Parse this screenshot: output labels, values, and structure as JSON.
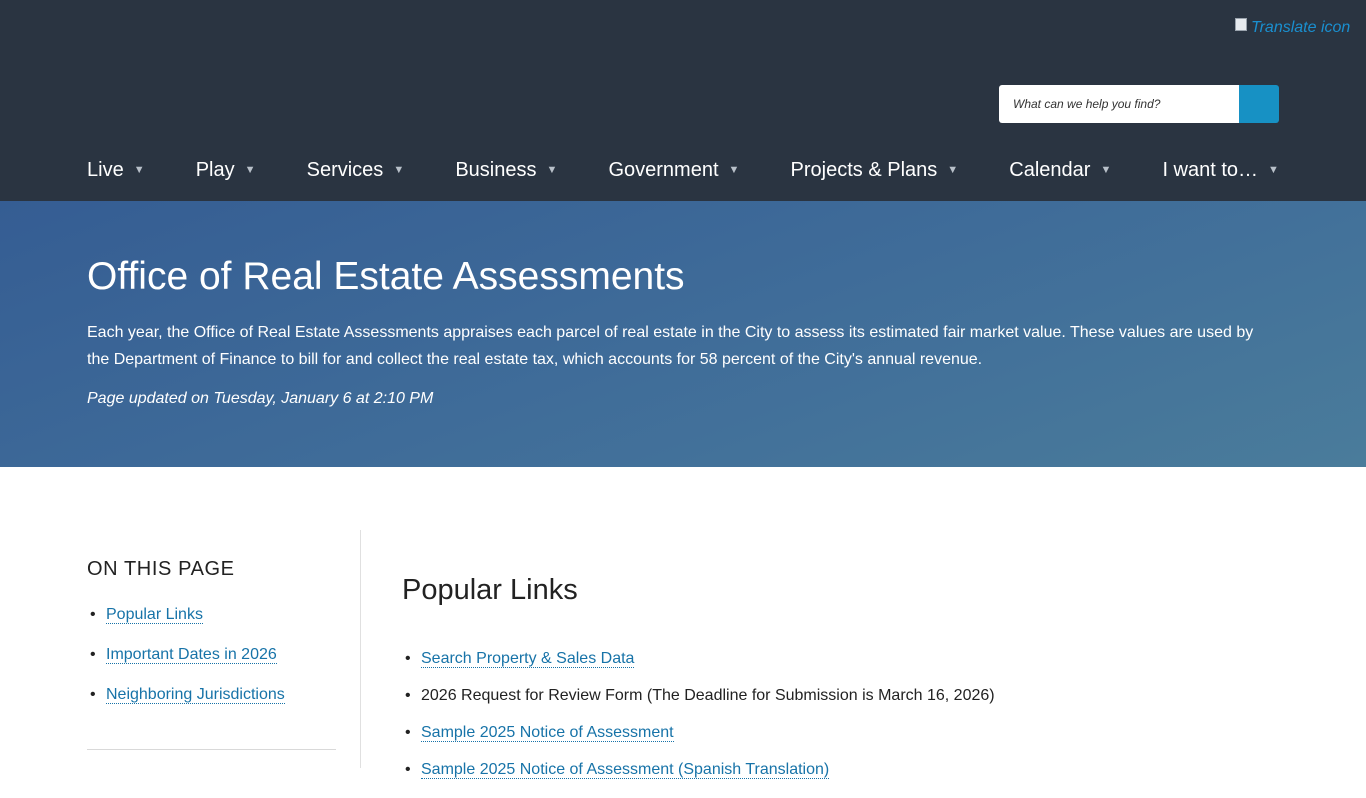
{
  "header": {
    "translate_alt": "Translate icon",
    "search": {
      "placeholder": "What can we help you find?"
    },
    "nav": [
      {
        "label": "Live"
      },
      {
        "label": "Play"
      },
      {
        "label": "Services"
      },
      {
        "label": "Business"
      },
      {
        "label": "Government"
      },
      {
        "label": "Projects & Plans"
      },
      {
        "label": "Calendar"
      },
      {
        "label": "I want to…"
      }
    ],
    "caret_glyph": "▼"
  },
  "hero": {
    "title": "Office of Real Estate Assessments",
    "intro": "Each year, the Office of Real Estate Assessments appraises each parcel of real estate in the City to assess its estimated fair market value. These values are used by the Department of Finance to bill for and collect the real estate tax, which accounts for 58 percent of the City's annual revenue.",
    "updated": "Page updated on Tuesday, January 6 at 2:10 PM"
  },
  "sidebar": {
    "heading": "ON THIS PAGE",
    "links": [
      {
        "label": "Popular Links"
      },
      {
        "label": "Important Dates in 2026"
      },
      {
        "label": "Neighboring Jurisdictions"
      }
    ]
  },
  "main": {
    "heading": "Popular Links",
    "items": [
      {
        "label": "Search Property & Sales Data",
        "is_link": true
      },
      {
        "label": "2026 Request for Review Form (The Deadline for Submission is March 16, 2026)",
        "is_link": false
      },
      {
        "label": "Sample 2025 Notice of Assessment",
        "is_link": true
      },
      {
        "label": "Sample 2025 Notice of Assessment (Spanish Translation)",
        "is_link": true
      }
    ]
  },
  "colors": {
    "header_bg": "#2a3441",
    "hero_gradient_start": "#355d93",
    "hero_gradient_end": "#4a7c9b",
    "link": "#1773a8",
    "search_button": "#1791c4"
  }
}
